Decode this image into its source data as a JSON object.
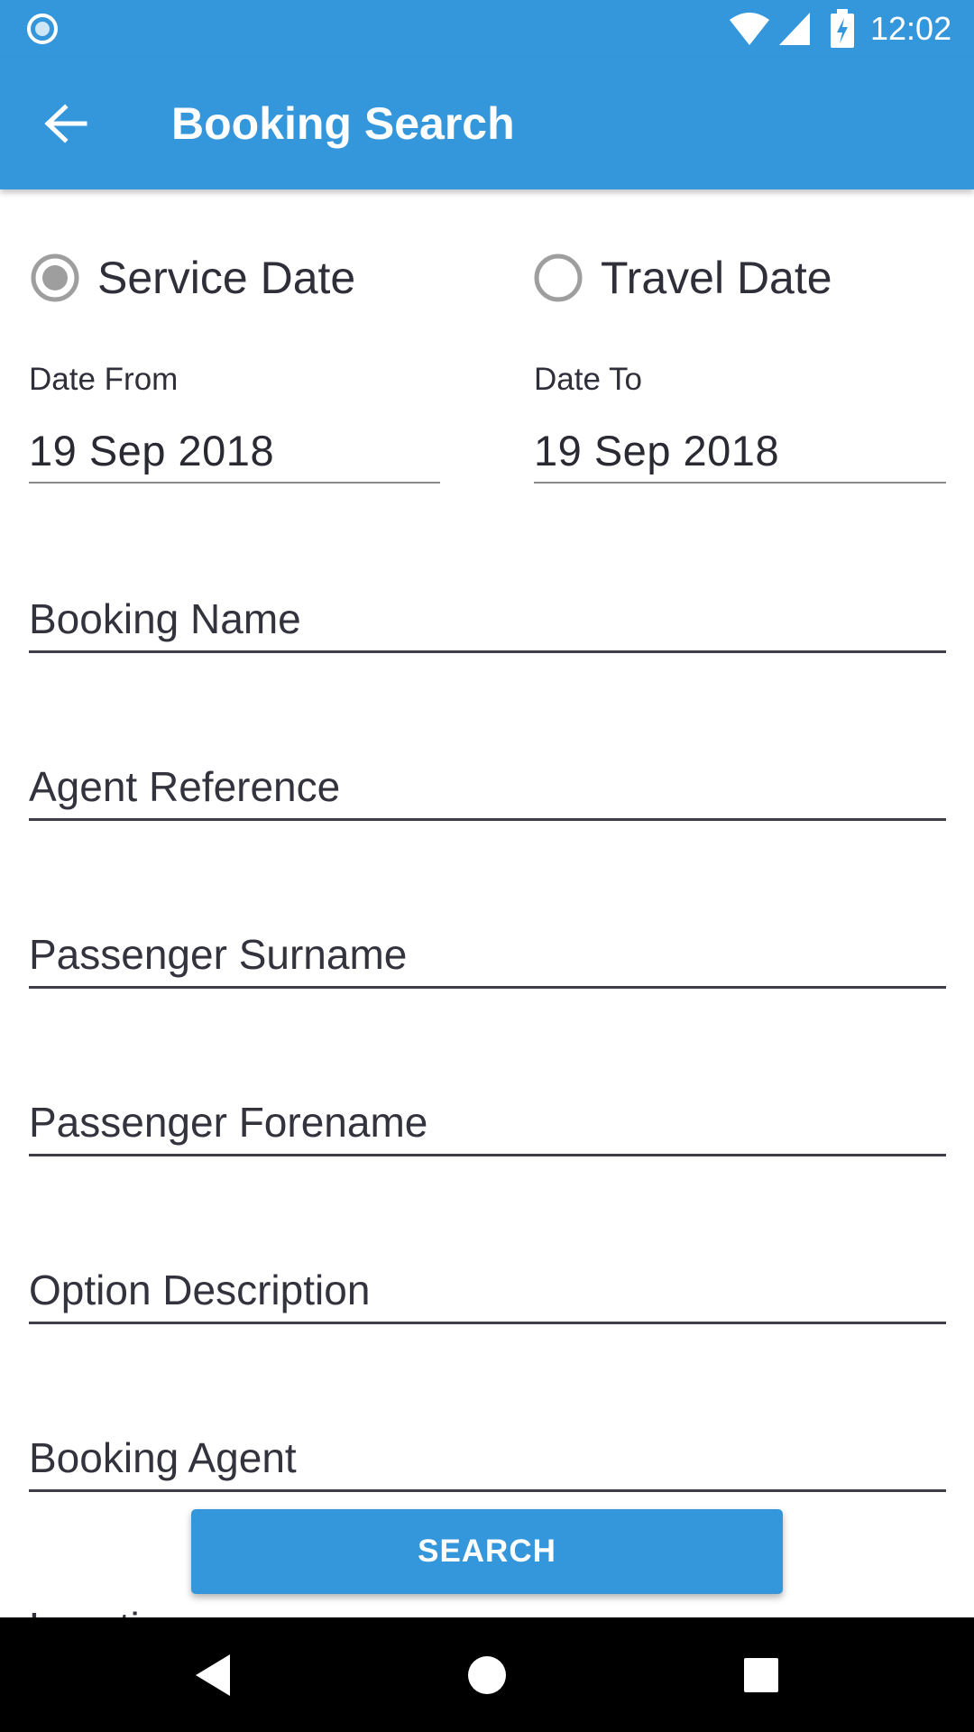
{
  "status_bar": {
    "time": "12:02",
    "icons": [
      "app-notification-icon",
      "wifi-icon",
      "cell-signal-icon",
      "battery-charging-icon"
    ]
  },
  "app_bar": {
    "title": "Booking Search",
    "back_icon": "arrow-left-icon"
  },
  "date_type": {
    "options": [
      {
        "label": "Service Date",
        "selected": true
      },
      {
        "label": "Travel Date",
        "selected": false
      }
    ]
  },
  "dates": {
    "from": {
      "caption": "Date From",
      "value": "19 Sep 2018"
    },
    "to": {
      "caption": "Date To",
      "value": "19 Sep 2018"
    }
  },
  "fields": {
    "booking_name": {
      "placeholder": "Booking Name",
      "value": ""
    },
    "agent_reference": {
      "placeholder": "Agent Reference",
      "value": ""
    },
    "passenger_surname": {
      "placeholder": "Passenger Surname",
      "value": ""
    },
    "passenger_forename": {
      "placeholder": "Passenger Forename",
      "value": ""
    },
    "option_description": {
      "placeholder": "Option Description",
      "value": ""
    },
    "booking_agent": {
      "placeholder": "Booking Agent",
      "value": ""
    }
  },
  "partial_field": {
    "label": "Location"
  },
  "search_button": {
    "label": "SEARCH"
  },
  "colors": {
    "primary": "#3597db",
    "text": "#2f2f3a",
    "nav_bar": "#000000",
    "radio_selected": "#9e9e9e",
    "radio_unselected": "#9e9e9e"
  },
  "nav_bar": {
    "icons": [
      "nav-back-icon",
      "nav-home-icon",
      "nav-recents-icon"
    ]
  }
}
